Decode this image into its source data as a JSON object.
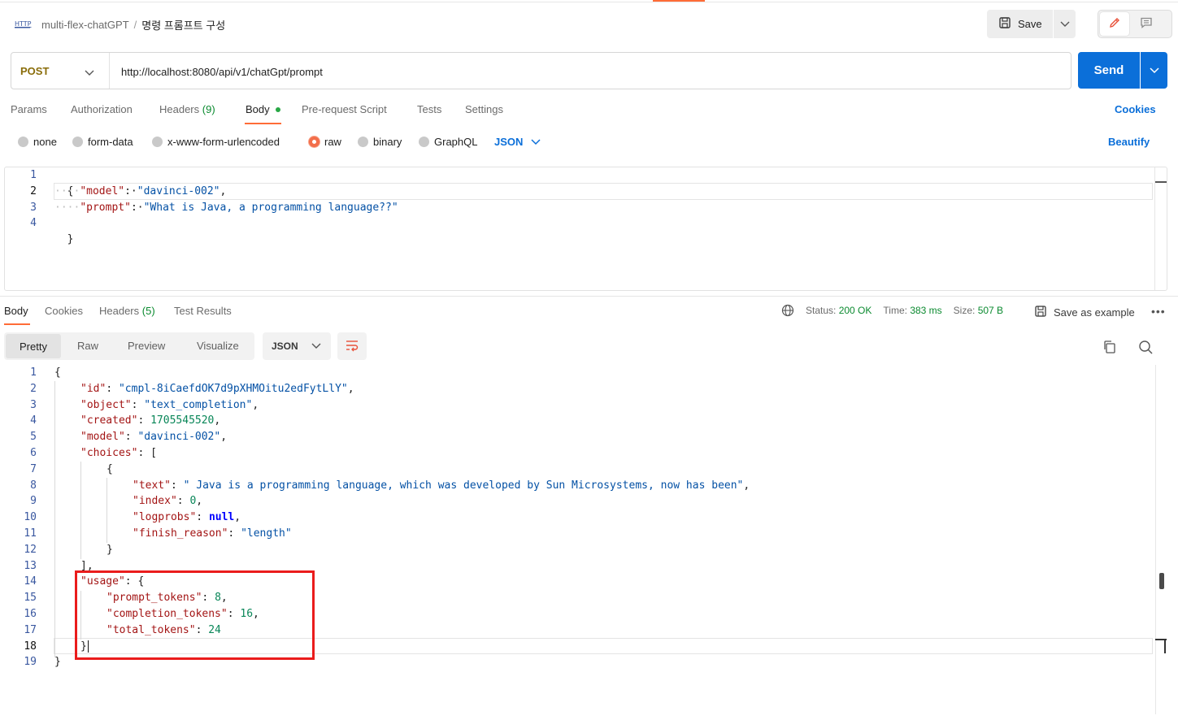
{
  "header": {
    "collection": "multi-flex-chatGPT",
    "separator": "/",
    "request_name": "명령 프롬프트 구성",
    "save_label": "Save"
  },
  "request": {
    "method": "POST",
    "url": "http://localhost:8080/api/v1/chatGpt/prompt",
    "send_label": "Send"
  },
  "request_tabs": {
    "params": "Params",
    "authorization": "Authorization",
    "headers": "Headers",
    "headers_count": "(9)",
    "body": "Body",
    "pre_request": "Pre-request Script",
    "tests": "Tests",
    "settings": "Settings",
    "cookies": "Cookies"
  },
  "body_types": {
    "none": "none",
    "form_data": "form-data",
    "urlencoded": "x-www-form-urlencoded",
    "raw": "raw",
    "binary": "binary",
    "graphql": "GraphQL",
    "selected": "raw",
    "format": "JSON",
    "beautify": "Beautify"
  },
  "request_body": {
    "line_numbers": [
      "1",
      "2",
      "3",
      "4"
    ],
    "open": "{",
    "model_key": "\"model\"",
    "model_value": "\"davinci-002\"",
    "prompt_key": "\"prompt\"",
    "prompt_value": "\"What is Java, a programming language??\"",
    "close": "}"
  },
  "response_tabs": {
    "body": "Body",
    "cookies": "Cookies",
    "headers": "Headers",
    "headers_count": "(5)",
    "test_results": "Test Results"
  },
  "response_status": {
    "status_label": "Status:",
    "status_value": "200 OK",
    "time_label": "Time:",
    "time_value": "383 ms",
    "size_label": "Size:",
    "size_value": "507 B",
    "save_example": "Save as example"
  },
  "response_view": {
    "pretty": "Pretty",
    "raw": "Raw",
    "preview": "Preview",
    "visualize": "Visualize",
    "format": "JSON"
  },
  "response_body": {
    "line_numbers": [
      "1",
      "2",
      "3",
      "4",
      "5",
      "6",
      "7",
      "8",
      "9",
      "10",
      "11",
      "12",
      "13",
      "14",
      "15",
      "16",
      "17",
      "18",
      "19"
    ],
    "id_key": "\"id\"",
    "id_value": "\"cmpl-8iCaefdOK7d9pXHMOitu2edFytLlY\"",
    "object_key": "\"object\"",
    "object_value": "\"text_completion\"",
    "created_key": "\"created\"",
    "created_value": "1705545520",
    "model_key": "\"model\"",
    "model_value": "\"davinci-002\"",
    "choices_key": "\"choices\"",
    "text_key": "\"text\"",
    "text_value": "\" Java is a programming language, which was developed by Sun Microsystems, now has been\"",
    "index_key": "\"index\"",
    "index_value": "0",
    "logprobs_key": "\"logprobs\"",
    "logprobs_value": "null",
    "finish_key": "\"finish_reason\"",
    "finish_value": "\"length\"",
    "usage_key": "\"usage\"",
    "prompt_tokens_key": "\"prompt_tokens\"",
    "prompt_tokens_value": "8",
    "completion_tokens_key": "\"completion_tokens\"",
    "completion_tokens_value": "16",
    "total_tokens_key": "\"total_tokens\"",
    "total_tokens_value": "24"
  },
  "colors": {
    "accent": "#ff6c37",
    "primary": "#0b6fd9",
    "success": "#0a8a2f",
    "highlight": "#ea1c1c"
  },
  "icons": [
    "http-icon",
    "save-icon",
    "chevron-down-icon",
    "pencil-icon",
    "comment-icon",
    "globe-icon",
    "floppy-icon",
    "more-icon",
    "wrap-icon",
    "copy-icon",
    "search-icon"
  ]
}
